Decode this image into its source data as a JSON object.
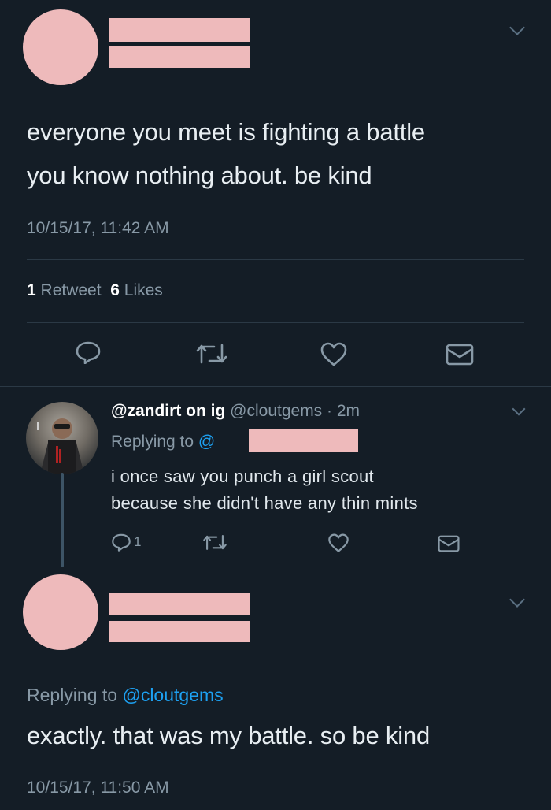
{
  "tweet1": {
    "text_line1": "everyone you meet is fighting a battle",
    "text_line2": "you know nothing about. be kind",
    "timestamp": "10/15/17, 11:42 AM",
    "retweet_count": "1",
    "retweet_label": "Retweet",
    "like_count": "6",
    "like_label": "Likes"
  },
  "reply": {
    "display_name": "@zandirt on ig",
    "handle_time": "@cloutgems · 2m",
    "replying_label": "Replying to",
    "replying_handle": "@",
    "text_line1": "i once saw you punch a girl scout",
    "text_line2": "because she didn't have any thin mints",
    "reply_count": "1"
  },
  "tweet2": {
    "replying_label": "Replying to",
    "replying_handle": "@cloutgems",
    "text": "exactly. that was my battle. so be kind",
    "timestamp": "10/15/17, 11:50 AM"
  },
  "colors": {
    "background": "#141d26",
    "redaction": "#eebabb",
    "link": "#1da1f2",
    "muted": "#8899a6"
  }
}
